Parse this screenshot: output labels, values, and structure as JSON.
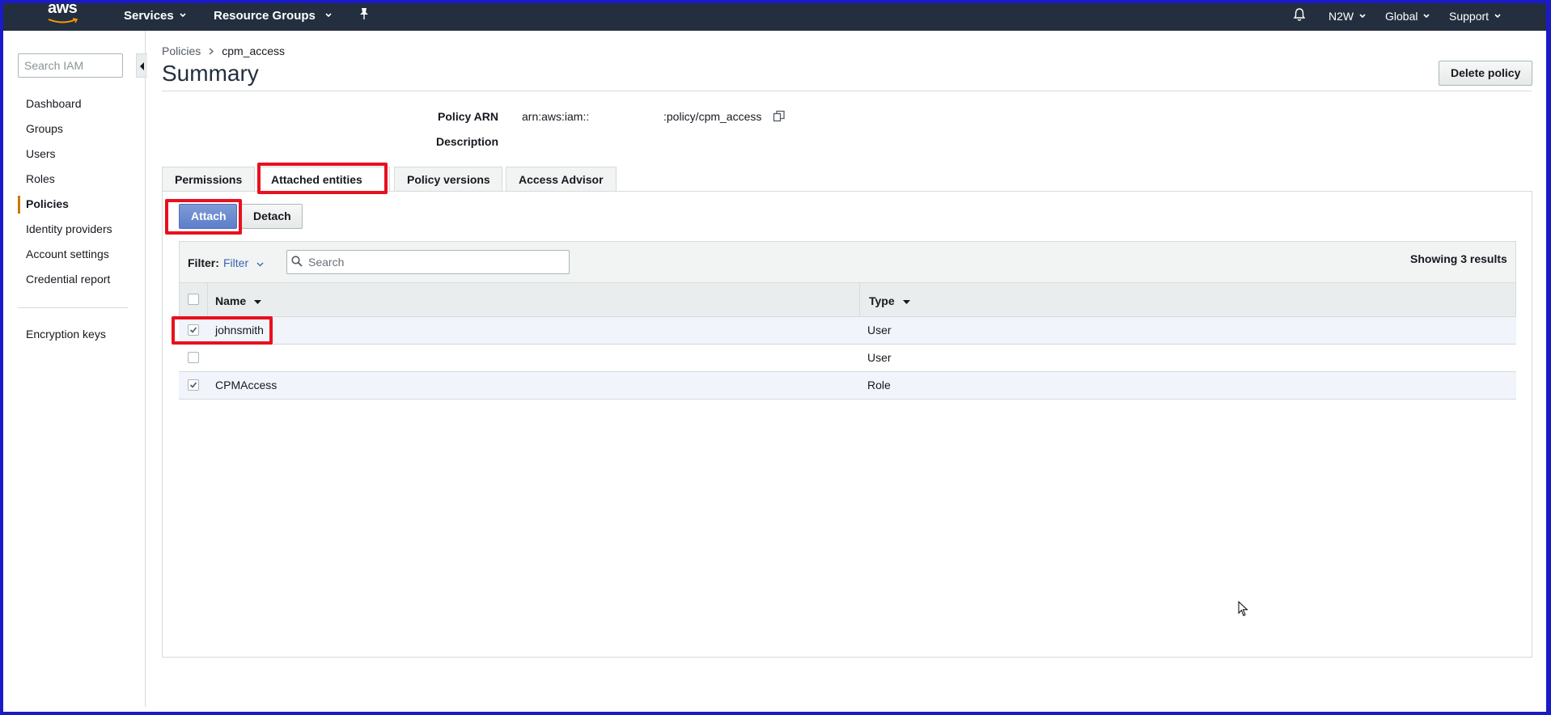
{
  "topnav": {
    "logo_text": "aws",
    "services": "Services",
    "resource_groups": "Resource Groups",
    "account": "N2W",
    "region": "Global",
    "support": "Support"
  },
  "sidebar": {
    "search_placeholder": "Search IAM",
    "items": [
      {
        "label": "Dashboard"
      },
      {
        "label": "Groups"
      },
      {
        "label": "Users"
      },
      {
        "label": "Roles"
      },
      {
        "label": "Policies",
        "active": true
      },
      {
        "label": "Identity providers"
      },
      {
        "label": "Account settings"
      },
      {
        "label": "Credential report"
      }
    ],
    "extra_items": [
      {
        "label": "Encryption keys"
      }
    ]
  },
  "breadcrumb": {
    "parent": "Policies",
    "current": "cpm_access"
  },
  "page": {
    "title": "Summary",
    "delete_button": "Delete policy"
  },
  "summary": {
    "arn_label": "Policy ARN",
    "arn_prefix": "arn:aws:iam::",
    "arn_suffix": ":policy/cpm_access",
    "description_label": "Description"
  },
  "tabs": [
    {
      "label": "Permissions"
    },
    {
      "label": "Attached entities",
      "active": true
    },
    {
      "label": "Policy versions"
    },
    {
      "label": "Access Advisor"
    }
  ],
  "actions": {
    "attach": "Attach",
    "detach": "Detach"
  },
  "table": {
    "filter_label": "Filter:",
    "filter_value": "Filter",
    "search_placeholder": "Search",
    "results_text": "Showing 3 results",
    "columns": [
      "Name",
      "Type"
    ],
    "rows": [
      {
        "name": "johnsmith",
        "type": "User",
        "checked": true
      },
      {
        "name": "",
        "type": "User",
        "checked": false
      },
      {
        "name": "CPMAccess",
        "type": "Role",
        "checked": true
      }
    ]
  },
  "colors": {
    "nav_bg": "#232f3e",
    "primary_button": "#5c7fcb",
    "highlight": "#e8101e",
    "frame": "#1a1ac8"
  }
}
